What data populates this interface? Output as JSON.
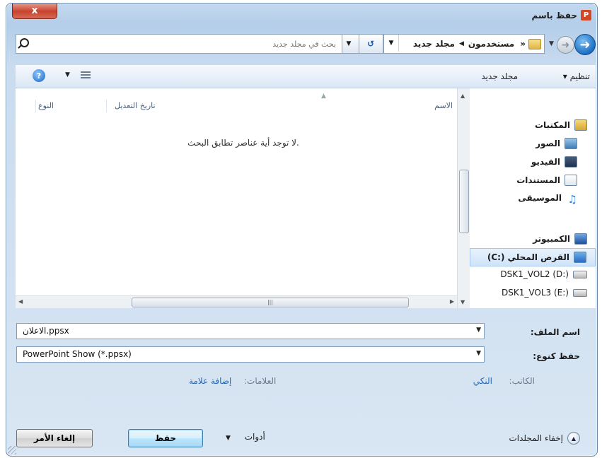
{
  "window": {
    "title": "حفظ باسم",
    "close_label": "x",
    "app_icon_glyph": "P",
    "accent": "#1b6fc3"
  },
  "address": {
    "breadcrumbs": [
      "«",
      "مستخدمون",
      "مجلد جديد"
    ],
    "search_placeholder": "بحث في مجلد جديد"
  },
  "toolbar": {
    "organize": "تنظيم ▾",
    "new_folder": "مجلد جديد"
  },
  "nav": {
    "libraries": "المكتبات",
    "pictures": "الصور",
    "videos": "الفيديو",
    "documents": "المستندات",
    "music": "الموسيقى",
    "computer": "الكمبيوتر",
    "local_disk": "القرص المحلي (:C)",
    "drive_d": "(:D) DSK1_VOL2",
    "drive_e": "(:E) DSK1_VOL3"
  },
  "columns": {
    "name": "الاسم",
    "date_modified": "تاريخ التعديل",
    "type": "النوع"
  },
  "empty_message": "لا توجد أية عناصر تطابق البحث.",
  "form": {
    "file_name_label": "اسم الملف:",
    "file_name_value": "الاعلان.ppsx",
    "save_type_label": "حفظ كنوع:",
    "save_type_value": "PowerPoint Show (*.ppsx)"
  },
  "meta": {
    "author_label": "الكاتب:",
    "author_value": "النكي",
    "tags_label": "العلامات:",
    "tags_value": "إضافة علامة"
  },
  "footer": {
    "hide_folders": "إخفاء المجلدات",
    "tools": "أدوات",
    "save_button": "حفظ",
    "cancel_button": "إلغاء الأمر"
  }
}
